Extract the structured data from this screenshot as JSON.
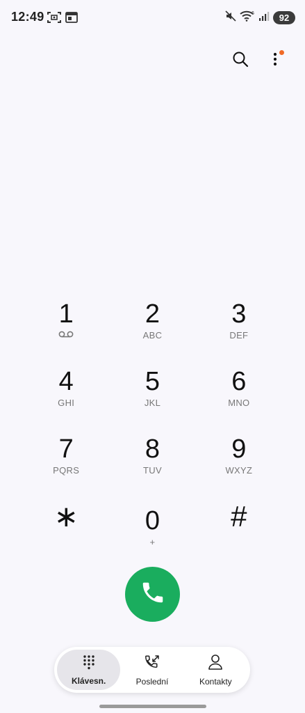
{
  "status_bar": {
    "time": "12:49",
    "battery": "92",
    "left_icons": [
      "screenshot-icon",
      "calendar-widget-icon"
    ],
    "right_icons": [
      "mute-icon",
      "wifi-icon",
      "signal-icon"
    ]
  },
  "top_actions": {
    "icons": [
      "search-icon",
      "more-options-icon"
    ],
    "notification_dot_color": "#f06a26"
  },
  "dialpad": {
    "keys": [
      {
        "digit": "1",
        "letters": "",
        "extra_icon": "voicemail-icon"
      },
      {
        "digit": "2",
        "letters": "ABC"
      },
      {
        "digit": "3",
        "letters": "DEF"
      },
      {
        "digit": "4",
        "letters": "GHI"
      },
      {
        "digit": "5",
        "letters": "JKL"
      },
      {
        "digit": "6",
        "letters": "MNO"
      },
      {
        "digit": "7",
        "letters": "PQRS"
      },
      {
        "digit": "8",
        "letters": "TUV"
      },
      {
        "digit": "9",
        "letters": "WXYZ"
      },
      {
        "digit": "∗",
        "letters": ""
      },
      {
        "digit": "0",
        "letters": "+"
      },
      {
        "digit": "#",
        "letters": ""
      }
    ]
  },
  "call_button": {
    "icon": "phone-icon",
    "color": "#1aad5e"
  },
  "bottom_nav": {
    "items": [
      {
        "label": "Klávesn.",
        "icon": "dialpad-icon",
        "active": true
      },
      {
        "label": "Poslední",
        "icon": "recent-calls-icon",
        "active": false
      },
      {
        "label": "Kontakty",
        "icon": "contact-icon",
        "active": false
      }
    ]
  }
}
